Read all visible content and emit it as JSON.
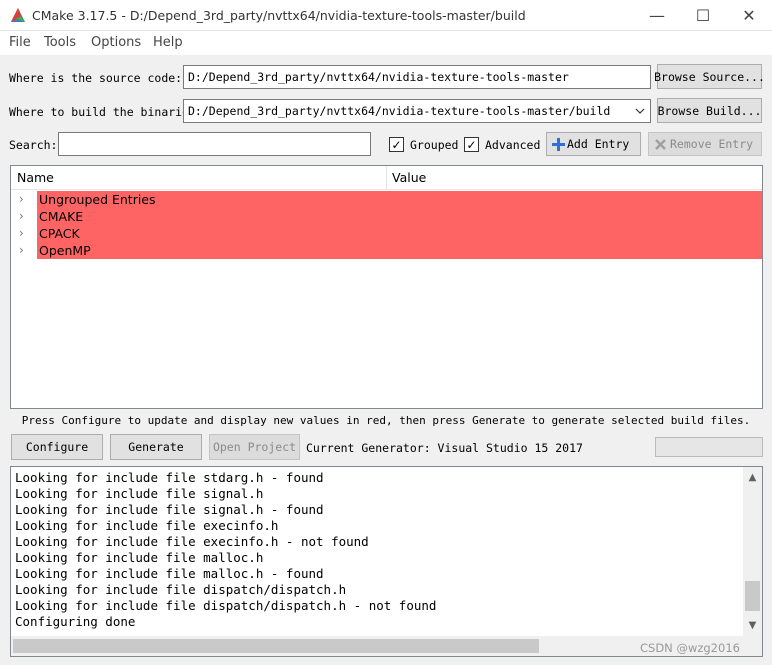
{
  "window": {
    "title": "CMake 3.17.5 - D:/Depend_3rd_party/nvttx64/nvidia-texture-tools-master/build",
    "minimize_glyph": "—",
    "maximize_glyph": "☐",
    "close_glyph": "✕"
  },
  "menu": [
    "File",
    "Tools",
    "Options",
    "Help"
  ],
  "source": {
    "label": "Where is the source code:",
    "value": "D:/Depend_3rd_party/nvttx64/nvidia-texture-tools-master",
    "browse_label": "Browse Source..."
  },
  "build": {
    "label": "Where to build the binaries:",
    "value": "D:/Depend_3rd_party/nvttx64/nvidia-texture-tools-master/build",
    "browse_label": "Browse Build..."
  },
  "search": {
    "label": "Search:",
    "value": "",
    "grouped_label": "Grouped",
    "grouped_checked": true,
    "advanced_label": "Advanced",
    "advanced_checked": true,
    "check_glyph": "✓",
    "add_entry_label": "Add Entry",
    "remove_entry_label": "Remove Entry"
  },
  "table": {
    "col_name": "Name",
    "col_value": "Value",
    "expand_glyph": "›",
    "highlight_color": "#ff6464",
    "rows": [
      "Ungrouped Entries",
      "CMAKE",
      "CPACK",
      "OpenMP"
    ]
  },
  "hint": "Press Configure to update and display new values in red, then press Generate to generate selected build files.",
  "actions": {
    "configure_label": "Configure",
    "generate_label": "Generate",
    "open_project_label": "Open Project",
    "generator_text": "Current Generator: Visual Studio 15 2017"
  },
  "output": {
    "lines": [
      "Looking for include file stdarg.h - found",
      "Looking for include file signal.h",
      "Looking for include file signal.h - found",
      "Looking for include file execinfo.h",
      "Looking for include file execinfo.h - not found",
      "Looking for include file malloc.h",
      "Looking for include file malloc.h - found",
      "Looking for include file dispatch/dispatch.h",
      "Looking for include file dispatch/dispatch.h - not found",
      "Configuring done"
    ],
    "scroll_up_glyph": "▲",
    "scroll_down_glyph": "▼"
  },
  "watermark": "CSDN @wzg2016"
}
